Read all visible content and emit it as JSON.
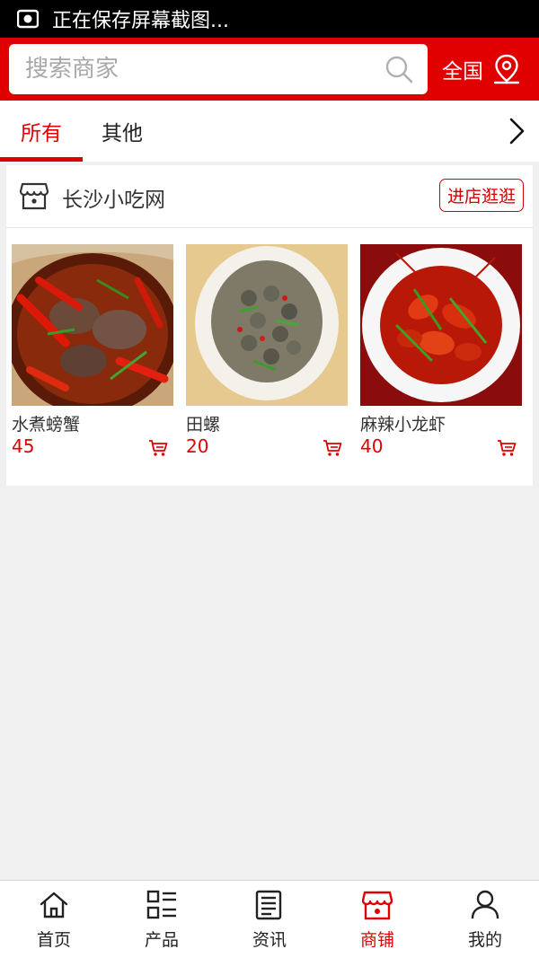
{
  "status_bar": {
    "text": "正在保存屏幕截图..."
  },
  "header": {
    "search_placeholder": "搜索商家",
    "region_label": "全国",
    "search_icon": "search-icon",
    "location_icon": "location-pin-icon"
  },
  "tabs": [
    {
      "label": "所有",
      "active": true
    },
    {
      "label": "其他",
      "active": false
    }
  ],
  "store": {
    "name": "长沙小吃网",
    "visit_label": "进店逛逛",
    "products": [
      {
        "name": "水煮螃蟹",
        "price": "45",
        "image": "spicy boiled crabs dish"
      },
      {
        "name": "田螺",
        "price": "20",
        "image": "stir-fried river snails dish"
      },
      {
        "name": "麻辣小龙虾",
        "price": "40",
        "image": "spicy crayfish dish"
      }
    ]
  },
  "bottom_nav": [
    {
      "label": "首页",
      "icon": "home-icon",
      "active": false
    },
    {
      "label": "产品",
      "icon": "grid-list-icon",
      "active": false
    },
    {
      "label": "资讯",
      "icon": "news-icon",
      "active": false
    },
    {
      "label": "商铺",
      "icon": "shop-icon",
      "active": true
    },
    {
      "label": "我的",
      "icon": "user-icon",
      "active": false
    }
  ],
  "colors": {
    "accent": "#e00000",
    "background": "#f0f0f0"
  }
}
